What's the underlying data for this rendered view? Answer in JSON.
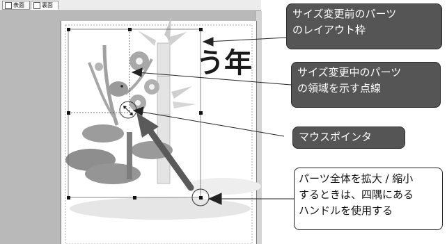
{
  "tabs": [
    {
      "label": "表面",
      "icon": "page-icon",
      "active": false
    },
    {
      "label": "裏面",
      "icon": "page-icon",
      "active": true
    }
  ],
  "design": {
    "calligraphy": "う年"
  },
  "callouts": {
    "before_resize_frame": [
      "サイズ変更前のパーツ",
      "のレイアウト枠"
    ],
    "resizing_dotted": [
      "サイズ変更中のパーツ",
      "の領域を示す点線"
    ],
    "mouse_pointer": [
      "マウスポインタ"
    ],
    "corner_handles": [
      "パーツ全体を拡大 / 縮小",
      "するときは、四隅にある",
      "ハンドルを使用する"
    ]
  },
  "colors": {
    "canvas": "#b9b9b9",
    "callout_dark": "#555555",
    "arrow": "#5a5a5a"
  }
}
